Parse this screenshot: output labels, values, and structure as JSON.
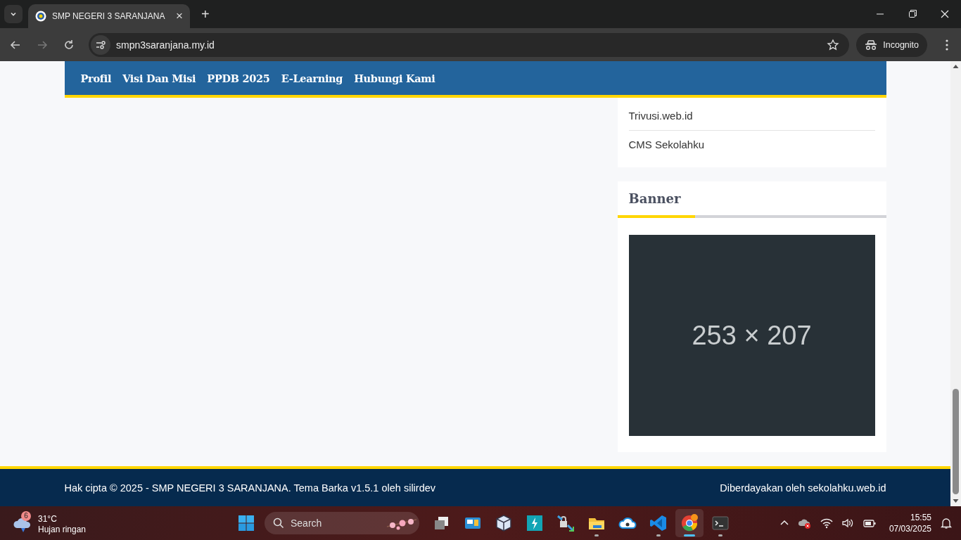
{
  "browser": {
    "tab": {
      "title": "SMP NEGERI 3 SARANJANA",
      "close": "×",
      "selected": true
    },
    "new_tab": "+",
    "address": "smpn3saranjana.my.id",
    "profile": "Incognito"
  },
  "nav": {
    "items": [
      {
        "label": "Profil"
      },
      {
        "label": "Visi Dan Misi"
      },
      {
        "label": "PPDB 2025"
      },
      {
        "label": "E-Learning"
      },
      {
        "label": "Hubungi Kami"
      }
    ]
  },
  "sidebar": {
    "links": [
      "Trivusi.web.id",
      "CMS Sekolahku"
    ],
    "banner": {
      "title": "Banner",
      "image_text": "253 × 207"
    }
  },
  "footer": {
    "copyright": "Hak cipta © 2025 - SMP NEGERI 3 SARANJANA. Tema Barka v1.5.1 oleh silirdev",
    "powered": "Diberdayakan oleh sekolahku.web.id"
  },
  "taskbar": {
    "weather": {
      "badge": "6",
      "temp": "31°C",
      "desc": "Hujan ringan"
    },
    "search": "Search",
    "apps": [
      {
        "running": false,
        "selected": false
      },
      {
        "running": false,
        "selected": false
      },
      {
        "running": false,
        "selected": false
      },
      {
        "running": false,
        "selected": false
      },
      {
        "running": false,
        "selected": false
      },
      {
        "running": true,
        "selected": false
      },
      {
        "running": false,
        "selected": false
      },
      {
        "running": true,
        "selected": false
      },
      {
        "running": true,
        "selected": true
      },
      {
        "running": true,
        "selected": false
      }
    ],
    "time": "15:55",
    "date": "07/03/2025"
  }
}
